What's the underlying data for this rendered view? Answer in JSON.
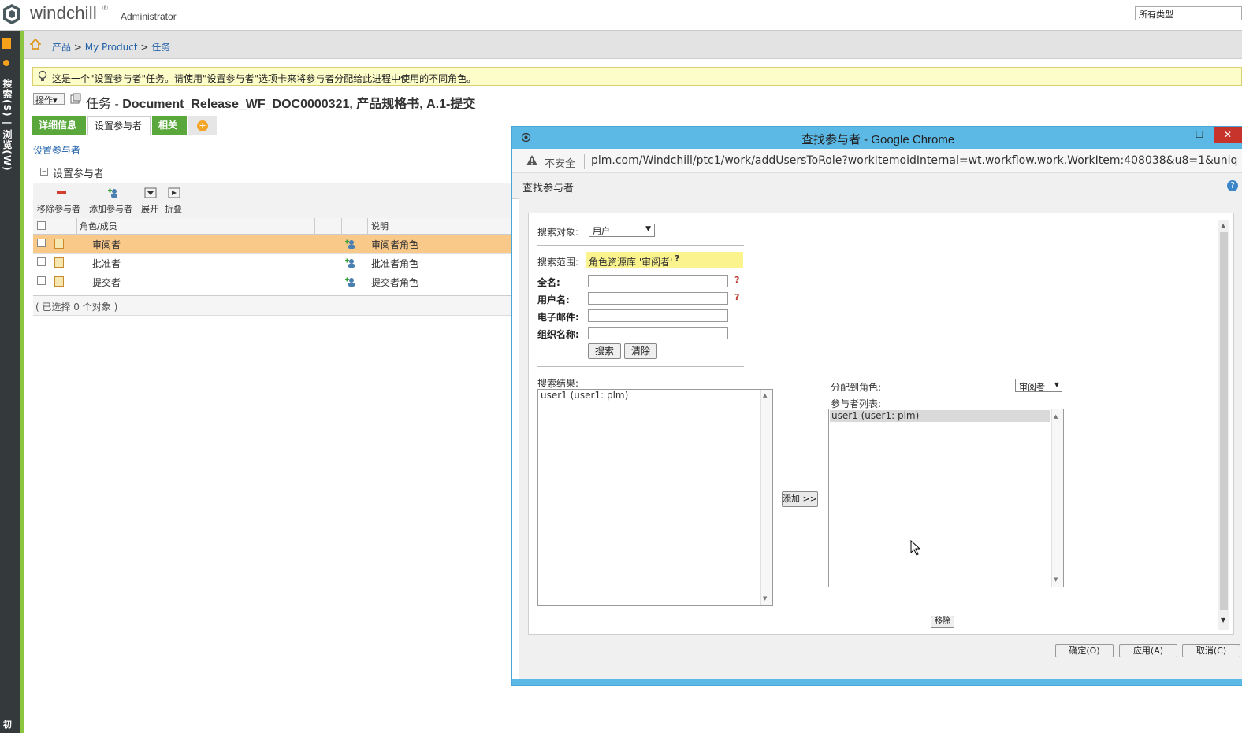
{
  "app": {
    "logo_text": "windchill",
    "logo_tm": "®",
    "user": "Administrator",
    "type_filter": "所有类型"
  },
  "sidebar": {
    "label": "搜索(S) | 浏览(W)",
    "bottom_label": "初"
  },
  "breadcrumb": {
    "items": [
      "产品",
      "My Product",
      "任务"
    ],
    "separator": ">"
  },
  "info_message": "这是一个\"设置参与者\"任务。请使用\"设置参与者\"选项卡来将参与者分配给此进程中使用的不同角色。",
  "task": {
    "actions_label": "操作▾",
    "prefix": "任务 - ",
    "title": "Document_Release_WF_DOC0000321, 产品规格书, A.1-提交"
  },
  "tabs": [
    {
      "label": "详细信息"
    },
    {
      "label": "设置参与者"
    },
    {
      "label": "相关"
    },
    {
      "label": "+"
    }
  ],
  "participants_page": {
    "sub_label": "设置参与者",
    "section_toggle": "⊟",
    "section_title": "设置参与者",
    "toolbar": [
      {
        "label": "移除参与者",
        "icon": "remove-icon"
      },
      {
        "label": "添加参与者",
        "icon": "add-user-icon"
      },
      {
        "label": "展开",
        "icon": "expand-icon"
      },
      {
        "label": "折叠",
        "icon": "collapse-icon"
      }
    ],
    "columns": [
      "角色/成员",
      "说明"
    ],
    "rows": [
      {
        "role": "审阅者",
        "desc": "审阅者角色",
        "selected": true
      },
      {
        "role": "批准者",
        "desc": "批准者角色",
        "selected": false
      },
      {
        "role": "提交者",
        "desc": "提交者角色",
        "selected": false
      }
    ],
    "selection_status": "( 已选择 0 个对象 )"
  },
  "popup": {
    "window_title": "查找参与者 - Google Chrome",
    "minimize": "—",
    "maximize": "☐",
    "close": "✕",
    "not_secure": "不安全",
    "url": "plm.com/Windchill/ptc1/work/addUsersToRole?workItemoidInternal=wt.workflow.work.WorkItem:408038&u8=1&uniqu...",
    "dialog_title": "查找参与者",
    "help": "?",
    "form": {
      "search_object_label": "搜索对象:",
      "search_object_value": "用户",
      "search_scope_label": "搜索范围:",
      "search_scope_value": "角色资源库 '审阅者'",
      "scope_help": "?",
      "fullname_label": "全名:",
      "fullname_value": "",
      "username_label": "用户名:",
      "username_value": "",
      "email_label": "电子邮件:",
      "email_value": "",
      "org_label": "组织名称:",
      "org_value": "",
      "field_help": "?",
      "search_button": "搜索",
      "clear_button": "清除"
    },
    "results": {
      "label": "搜索结果:",
      "items": [
        "user1 (user1: plm)"
      ]
    },
    "add_button": "添加 >>",
    "assign": {
      "role_label": "分配到角色:",
      "role_value": "审阅者",
      "list_label": "参与者列表:",
      "items": [
        "user1 (user1: plm)"
      ]
    },
    "remove_button": "移除",
    "footer": {
      "ok": "确定(O)",
      "apply": "应用(A)",
      "cancel": "取消(C)"
    }
  },
  "colors": {
    "sidebar": "#34393b",
    "sidebar_stripe": "#8cc63f",
    "tab_green": "#5aa83b",
    "selected_row": "#f9c98a",
    "chrome_blue": "#5cb9e6",
    "info_yellow": "#fdfdc9",
    "scope_yellow": "#fbf48e"
  }
}
